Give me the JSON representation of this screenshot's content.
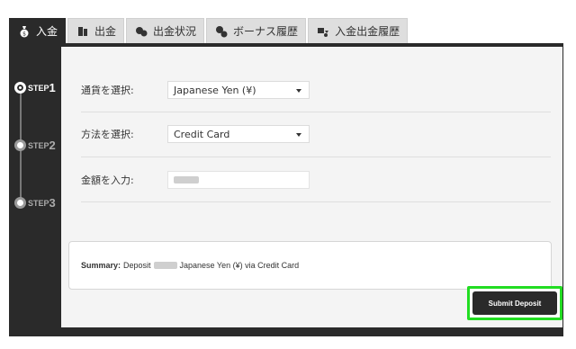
{
  "tabs": [
    {
      "label": "入金",
      "icon": "money-bag-icon",
      "active": true
    },
    {
      "label": "出金",
      "icon": "bill-stack-icon",
      "active": false
    },
    {
      "label": "出金状況",
      "icon": "coins-clock-icon",
      "active": false
    },
    {
      "label": "ボーナス履歴",
      "icon": "bonus-coins-icon",
      "active": false
    },
    {
      "label": "入金出金履歴",
      "icon": "exchange-history-icon",
      "active": false
    }
  ],
  "steps": [
    {
      "label": "STEP",
      "num": "1",
      "active": true
    },
    {
      "label": "STEP",
      "num": "2",
      "active": false
    },
    {
      "label": "STEP",
      "num": "3",
      "active": false
    }
  ],
  "form": {
    "currency_label": "通貨を選択:",
    "currency_value": "Japanese Yen (¥)",
    "method_label": "方法を選択:",
    "method_value": "Credit Card",
    "amount_label": "金額を入力:"
  },
  "summary": {
    "prefix": "Summary:",
    "deposit_word": "Deposit",
    "tail": "Japanese Yen (¥) via Credit Card"
  },
  "submit_label": "Submit Deposit",
  "colors": {
    "dark": "#2a2a2a",
    "highlight": "#22dd22",
    "panel": "#f4f4f4"
  }
}
